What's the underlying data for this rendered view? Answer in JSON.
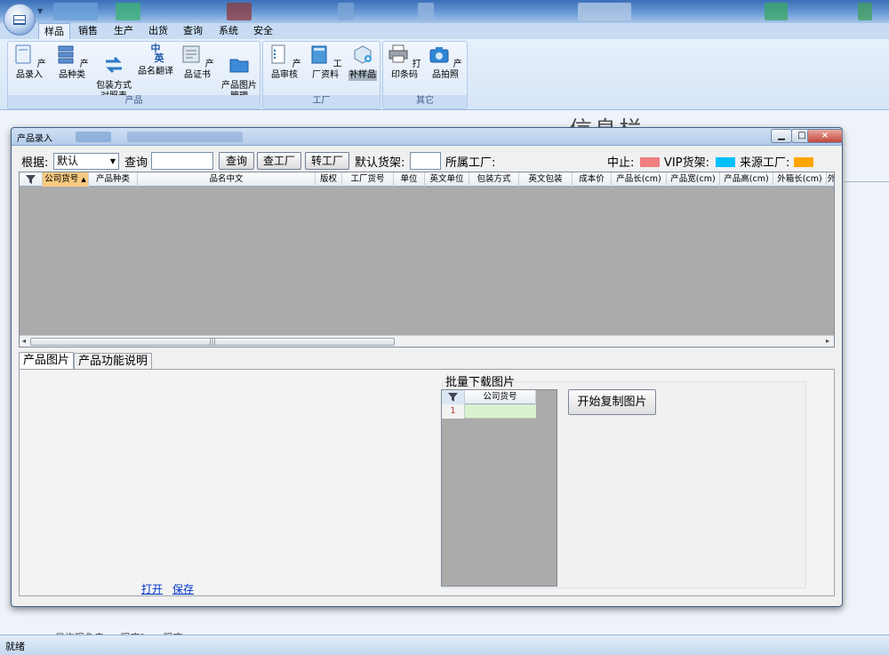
{
  "ribbon": {
    "tabs": [
      "样品",
      "销售",
      "生产",
      "出货",
      "查询",
      "系统",
      "安全"
    ],
    "active_tab": "样品",
    "groups": [
      {
        "label": "产品",
        "buttons": [
          "产品录入",
          "产品种类",
          "包装方式\n对照表",
          "品名翻译",
          "产品证书",
          "产品图片\n管理"
        ]
      },
      {
        "label": "工厂",
        "buttons": [
          "产品审核",
          "工厂资料",
          "补样品"
        ]
      },
      {
        "label": "其它",
        "buttons": [
          "打印条码",
          "产品拍照"
        ]
      }
    ],
    "translate_icon_text": {
      "top": "中",
      "bottom": "英"
    }
  },
  "background": {
    "title": "信息栏",
    "text": "只许现色走ran程序for…程序"
  },
  "dialog": {
    "title": "产品录入",
    "close_glyph": "×",
    "toolbar": {
      "basis_label": "根据:",
      "basis_value": "默认",
      "query_label": "查询",
      "query_value": "",
      "query_button": "查询",
      "check_factory_button": "查工厂",
      "transfer_factory_button": "转工厂",
      "default_shelf_label": "默认货架:",
      "default_shelf_value": "",
      "factory_label": "所属工厂:",
      "legend": [
        {
          "label": "中止:",
          "color": "#f08080"
        },
        {
          "label": "VIP货架:",
          "color": "#00bfff"
        },
        {
          "label": "来源工厂:",
          "color": "#ffa500"
        }
      ]
    },
    "grid": {
      "columns": [
        "公司货号",
        "产品种类",
        "品名中文",
        "版权",
        "工厂货号",
        "单位",
        "英文单位",
        "包装方式",
        "英文包装",
        "成本价",
        "产品长(cm)",
        "产品宽(cm)",
        "产品高(cm)",
        "外箱长(cm)",
        "外"
      ],
      "highlight_color": "#f7c981",
      "scroll_thumb": "|||"
    },
    "tabs": [
      "产品图片",
      "产品功能说明"
    ],
    "active_tab": "产品图片",
    "links": {
      "open": "打开",
      "save": "保存"
    },
    "batch": {
      "title": "批量下载图片",
      "column": "公司货号",
      "row_number": "1",
      "start_button": "开始复制图片"
    }
  },
  "status": {
    "text": "就绪"
  }
}
